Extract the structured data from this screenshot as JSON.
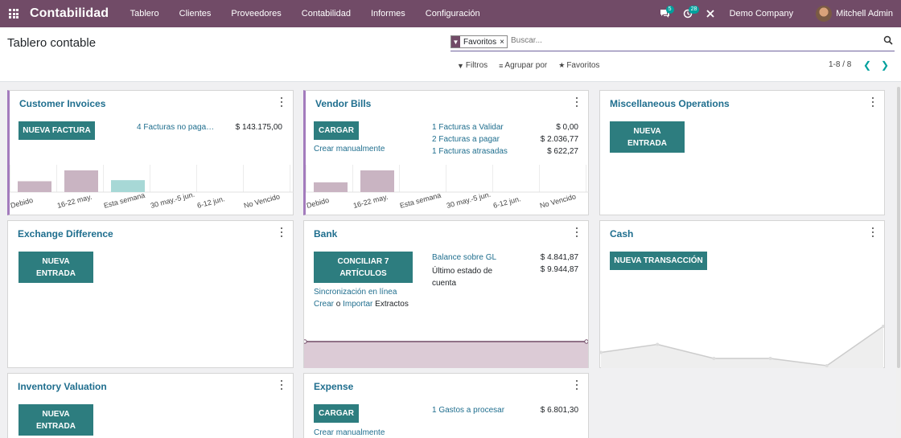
{
  "navbar": {
    "brand": "Contabilidad",
    "menu": [
      "Tablero",
      "Clientes",
      "Proveedores",
      "Contabilidad",
      "Informes",
      "Configuración"
    ],
    "messages_count": "5",
    "activities_count": "28",
    "company": "Demo Company",
    "user": "Mitchell Admin",
    "bg_color": "#714b67"
  },
  "control": {
    "title": "Tablero contable",
    "facet_label": "Favoritos",
    "search_placeholder": "Buscar...",
    "filters": "Filtros",
    "group_by": "Agrupar por",
    "favorites": "Favoritos",
    "pager": "1-8 / 8"
  },
  "cards": {
    "customer_invoices": {
      "title": "Customer Invoices",
      "button": "NUEVA FACTURA",
      "link": "4 Facturas no paga…",
      "amount": "$ 143.175,00"
    },
    "vendor_bills": {
      "title": "Vendor Bills",
      "button": "CARGAR",
      "secondary": "Crear manualmente",
      "rows": [
        {
          "label": "1 Facturas a Validar",
          "amount": "$ 0,00"
        },
        {
          "label": "2 Facturas a pagar",
          "amount": "$ 2.036,77"
        },
        {
          "label": "1 Facturas atrasadas",
          "amount": "$ 622,27"
        }
      ]
    },
    "misc": {
      "title": "Miscellaneous Operations",
      "button_l1": "NUEVA",
      "button_l2": "ENTRADA"
    },
    "exchange": {
      "title": "Exchange Difference",
      "button_l1": "NUEVA",
      "button_l2": "ENTRADA"
    },
    "bank": {
      "title": "Bank",
      "button_l1": "CONCILIAR 7",
      "button_l2": "ARTÍCULOS",
      "sync": "Sincronización en línea",
      "create": "Crear",
      "or": "o",
      "import": "Importar",
      "statements": "Extractos",
      "balance_label": "Balance sobre GL",
      "balance_amount": "$ 4.841,87",
      "last_label_l1": "Último estado de",
      "last_label_l2": "cuenta",
      "last_amount": "$ 9.944,87"
    },
    "cash": {
      "title": "Cash",
      "button": "NUEVA TRANSACCIÓN"
    },
    "inventory": {
      "title": "Inventory Valuation",
      "button_l1": "NUEVA",
      "button_l2": "ENTRADA"
    },
    "expense": {
      "title": "Expense",
      "button": "CARGAR",
      "secondary": "Crear manualmente",
      "link": "1 Gastos a procesar",
      "amount": "$ 6.801,30"
    }
  },
  "chart_data": [
    {
      "type": "bar",
      "categories": [
        "Debido",
        "16-22 may.",
        "Esta semana",
        "30 may.-5 jun.",
        "6-12 jun.",
        "No Vencido"
      ],
      "values": [
        0.5,
        1.0,
        0.55,
        0,
        0,
        0
      ],
      "colors": [
        "#c9b4c2",
        "#c9b4c2",
        "#a7d8d6",
        "#c9b4c2",
        "#c9b4c2",
        "#c9b4c2"
      ]
    },
    {
      "type": "bar",
      "categories": [
        "Debido",
        "16-22 may.",
        "Esta semana",
        "30 may.-5 jun.",
        "6-12 jun.",
        "No Vencido"
      ],
      "values": [
        0.45,
        1.0,
        0,
        0,
        0,
        0
      ],
      "colors": [
        "#c9b4c2",
        "#c9b4c2",
        "#c9b4c2",
        "#c9b4c2",
        "#c9b4c2",
        "#c9b4c2"
      ]
    },
    {
      "type": "area",
      "values": [
        4841.87,
        4841.87
      ],
      "color": "#714b67"
    },
    {
      "type": "line",
      "values": [
        0.35,
        0.55,
        0.2,
        0.2,
        0.02,
        1.0
      ],
      "color": "#cccccc"
    }
  ]
}
